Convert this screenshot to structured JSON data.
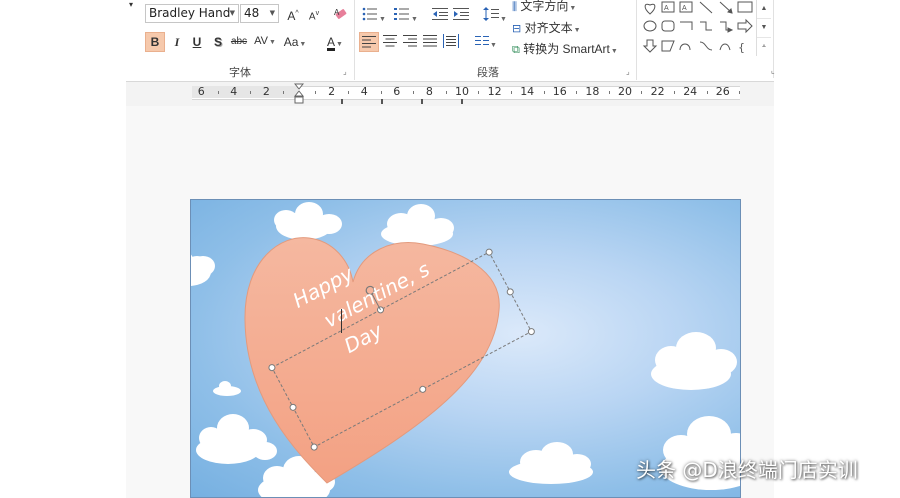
{
  "ribbon": {
    "font_group": {
      "font_name": "Bradley Hand",
      "font_size": "48",
      "grow_font": "A",
      "shrink_font": "A",
      "bold": "B",
      "italic": "I",
      "underline": "U",
      "shadow": "S",
      "strikethrough": "abc",
      "spacing": "AV",
      "change_case": "Aa",
      "font_color": "A",
      "label": "字体"
    },
    "paragraph_group": {
      "label": "段落"
    },
    "text_group": {
      "text_direction": "文字方向",
      "align_text": "对齐文本",
      "convert_smartart": "转换为 SmartArt"
    }
  },
  "ruler": {
    "left_labels": [
      "6",
      "4",
      "2"
    ],
    "right_labels": [
      "2",
      "4",
      "6",
      "8",
      "10",
      "12",
      "14",
      "16",
      "18",
      "20",
      "22",
      "24",
      "26"
    ]
  },
  "slide": {
    "text_lines": [
      "Happy",
      "valentine, s",
      "Day"
    ],
    "colors": {
      "heart": "#f4ab8f",
      "sky": "#8fbfe8",
      "cloud": "#ffffff"
    }
  },
  "watermark": "头条 @D浪终端门店实训"
}
